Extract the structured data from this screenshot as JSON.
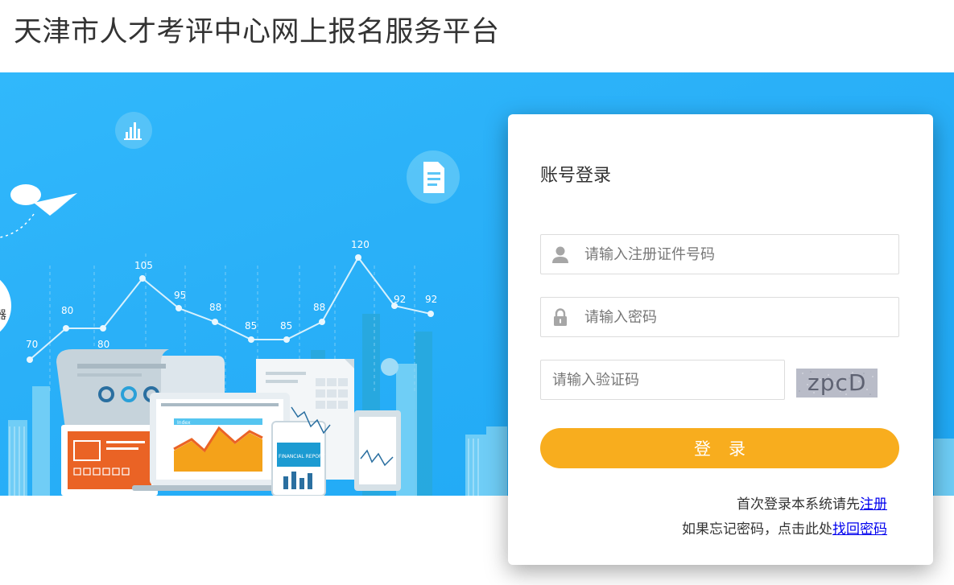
{
  "header": {
    "title": "天津市人才考评中心网上报名服务平台"
  },
  "banner": {
    "chart_labels": [
      "70",
      "80",
      "80",
      "105",
      "95",
      "88",
      "85",
      "85",
      "88",
      "120",
      "92",
      "92"
    ],
    "side_glyph": "器",
    "report_label": "FINANCIAL REPORT",
    "doc_label": "Index"
  },
  "login": {
    "title": "账号登录",
    "id_placeholder": "请输入注册证件号码",
    "password_placeholder": "请输入密码",
    "captcha_placeholder": "请输入验证码",
    "captcha_code": "zpcD",
    "submit_label": "登录",
    "register_prefix": "首次登录本系统请先",
    "register_link": "注册",
    "forgot_prefix": "如果忘记密码，点击此处",
    "forgot_link": "找回密码"
  },
  "colors": {
    "banner_blue": "#2ab0f8",
    "button_orange": "#f8ad1e",
    "link_blue": "#0000ee"
  },
  "icons": {
    "user": "user-icon",
    "lock": "lock-icon",
    "bar_chart": "bar-chart-icon",
    "document": "document-icon",
    "paper_plane": "paper-plane-icon"
  }
}
